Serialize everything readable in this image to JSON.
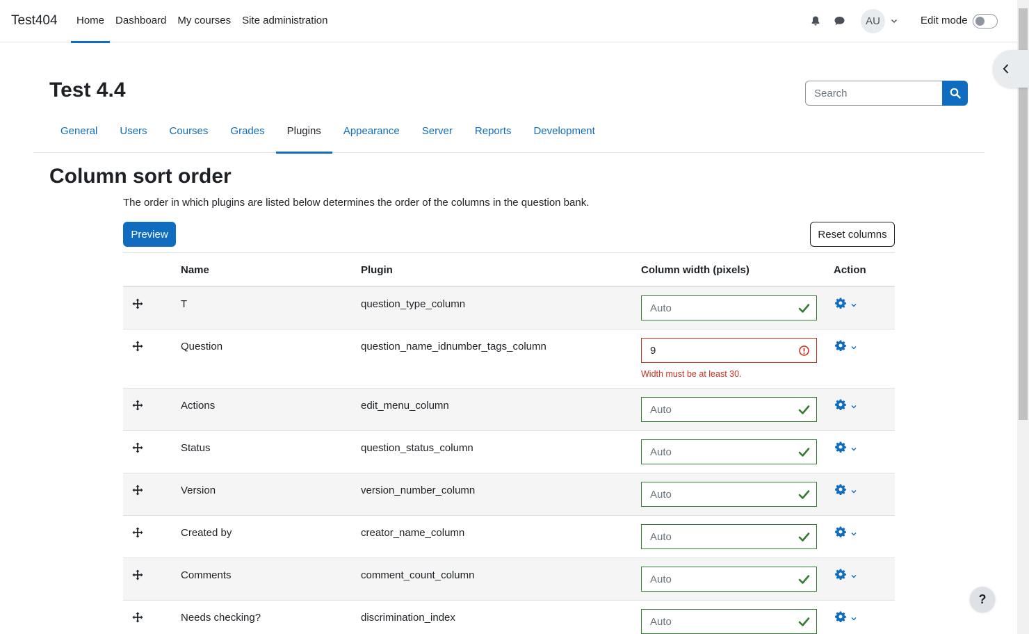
{
  "navbar": {
    "brand": "Test404",
    "items": [
      "Home",
      "Dashboard",
      "My courses",
      "Site administration"
    ],
    "active_index": 0,
    "notifications_icon": "bell-icon",
    "messages_icon": "chat-bubble-icon",
    "user_initials": "AU",
    "edit_mode_label": "Edit mode",
    "edit_mode_on": false
  },
  "header": {
    "title": "Test 4.4",
    "search_placeholder": "Search"
  },
  "secondary_nav": {
    "tabs": [
      "General",
      "Users",
      "Courses",
      "Grades",
      "Plugins",
      "Appearance",
      "Server",
      "Reports",
      "Development"
    ],
    "active_index": 4
  },
  "section": {
    "title": "Column sort order",
    "description": "The order in which plugins are listed below determines the order of the columns in the question bank.",
    "preview_label": "Preview",
    "reset_label": "Reset columns"
  },
  "table": {
    "headers": {
      "name": "Name",
      "plugin": "Plugin",
      "width": "Column width (pixels)",
      "action": "Action"
    },
    "width_placeholder": "Auto",
    "rows": [
      {
        "name": "T",
        "plugin": "question_type_column",
        "width": "",
        "valid": true
      },
      {
        "name": "Question",
        "plugin": "question_name_idnumber_tags_column",
        "width": "9",
        "valid": false,
        "error": "Width must be at least 30."
      },
      {
        "name": "Actions",
        "plugin": "edit_menu_column",
        "width": "",
        "valid": true
      },
      {
        "name": "Status",
        "plugin": "question_status_column",
        "width": "",
        "valid": true
      },
      {
        "name": "Version",
        "plugin": "version_number_column",
        "width": "",
        "valid": true
      },
      {
        "name": "Created by",
        "plugin": "creator_name_column",
        "width": "",
        "valid": true
      },
      {
        "name": "Comments",
        "plugin": "comment_count_column",
        "width": "",
        "valid": true
      },
      {
        "name": "Needs checking?",
        "plugin": "discrimination_index",
        "width": "",
        "valid": true
      }
    ]
  },
  "help_label": "?",
  "colors": {
    "primary": "#0f6cbf",
    "success": "#357a32",
    "danger": "#ca3120"
  }
}
